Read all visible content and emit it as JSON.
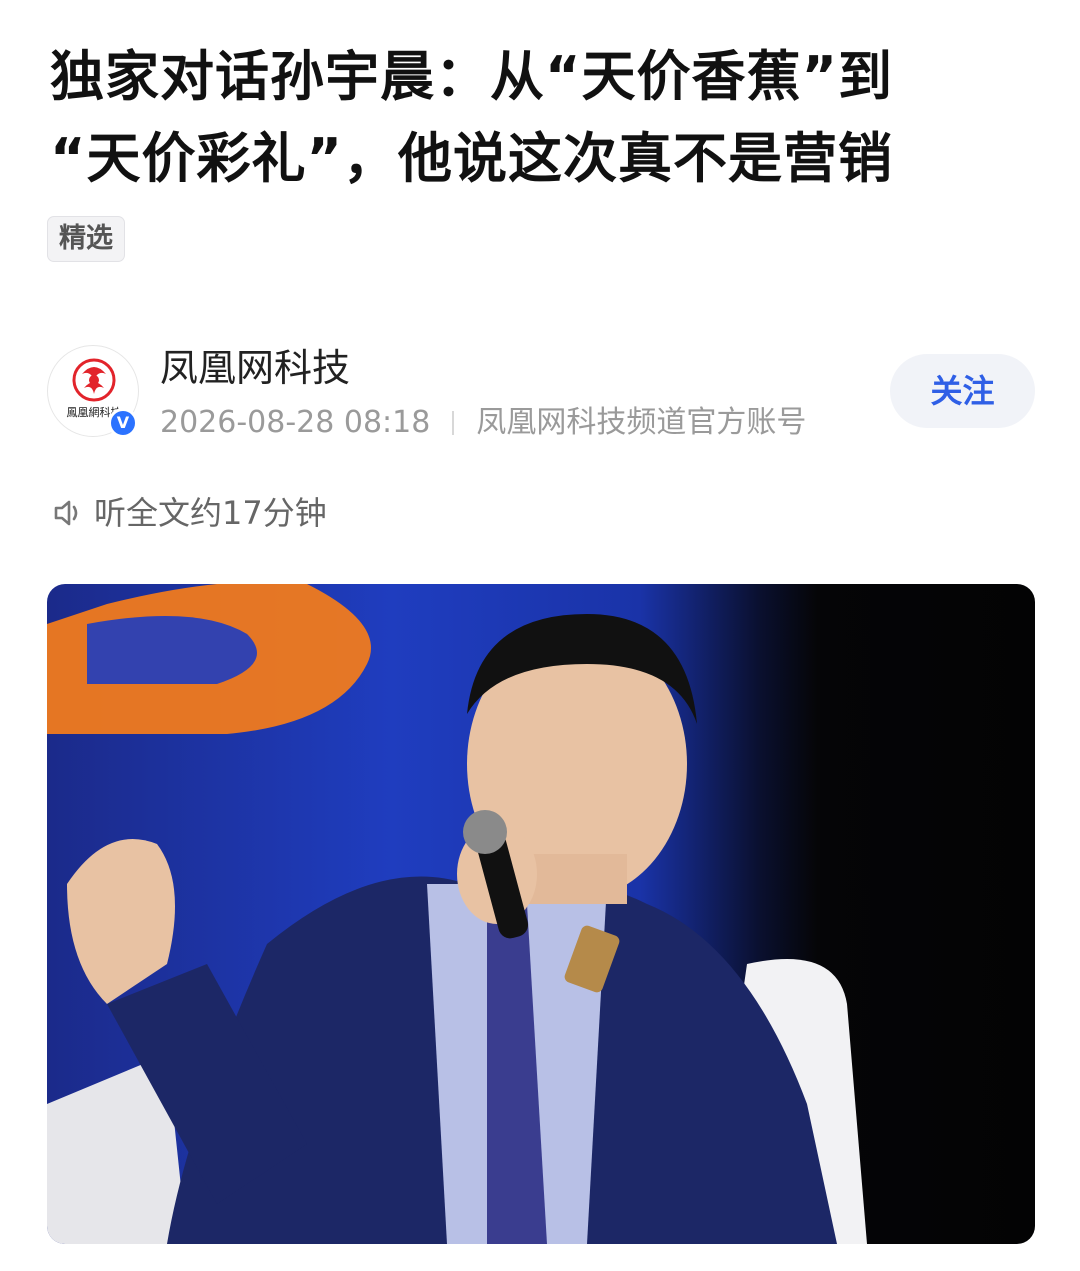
{
  "article": {
    "title_line1": "独家对话孙宇晨：从“天价香蕉”到",
    "title_line2": "“天价彩礼”，他说这次真不是营销",
    "tag": "精选"
  },
  "author": {
    "name": "凤凰网科技",
    "avatar_text": "鳳凰網科技",
    "verified_mark": "V",
    "timestamp": "2026-08-28 08:18",
    "description": "凤凰网科技频道官方账号",
    "follow_label": "关注"
  },
  "audio": {
    "listen_label": "听全文约17分钟",
    "icon": "speaker-icon"
  },
  "hero_image": {
    "icon": "photo",
    "colors": {
      "background_blue": "#1f3dbf",
      "accent_orange": "#f07a1e",
      "suit_navy": "#1c2766"
    }
  },
  "colors": {
    "accent_blue": "#2f5fe6",
    "verified_blue": "#2b72ff",
    "logo_red": "#e2242b"
  }
}
